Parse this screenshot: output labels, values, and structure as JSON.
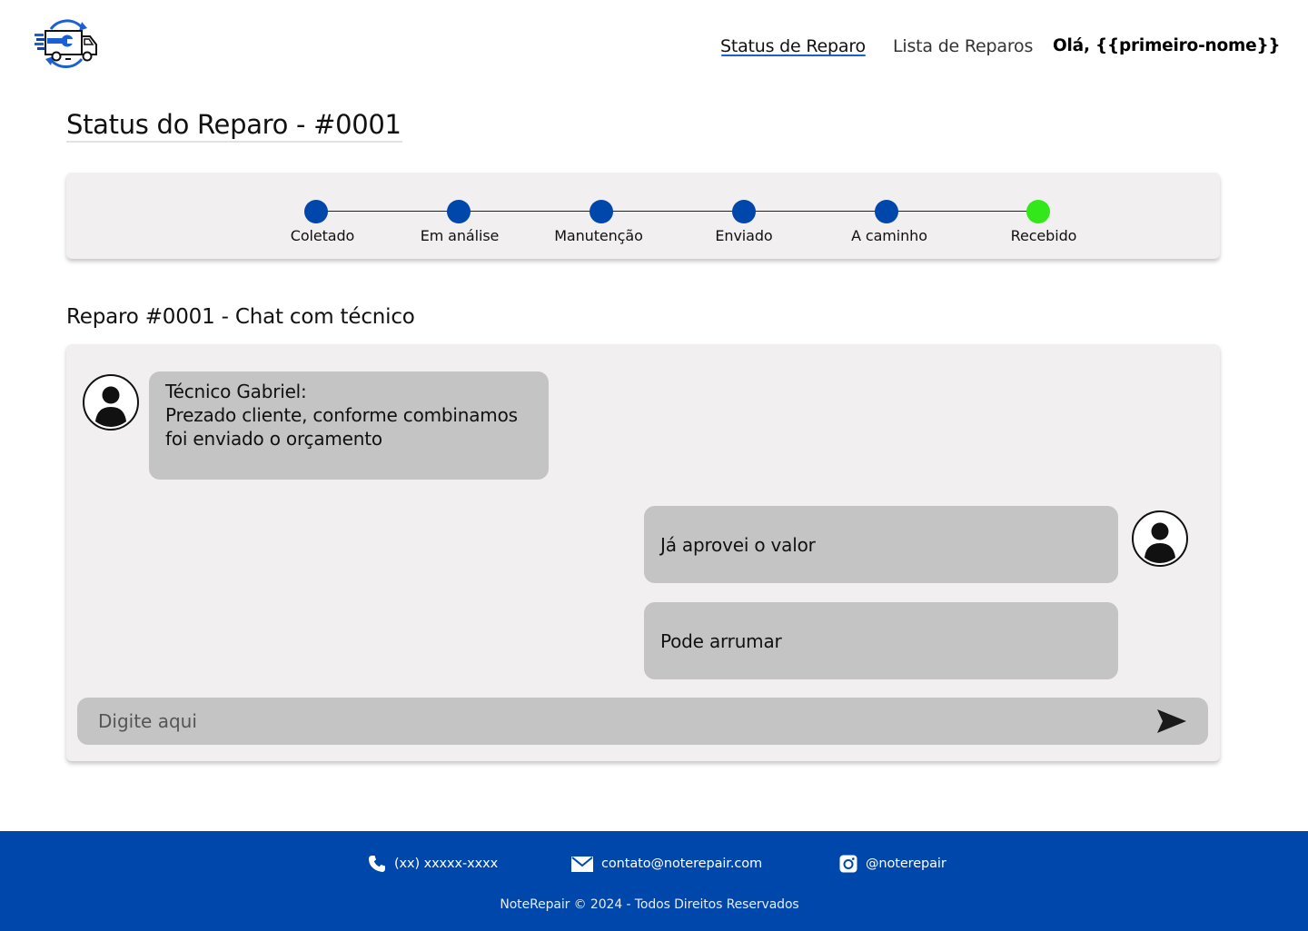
{
  "header": {
    "logo_name": "noterepair-truck-logo",
    "nav": {
      "status": "Status de Reparo",
      "list": "Lista de Reparos",
      "greeting": "Olá, {{primeiro-nome}}"
    }
  },
  "page": {
    "title": "Status do Reparo - #0001"
  },
  "progress": {
    "steps": [
      {
        "label": "Coletado",
        "state": "done"
      },
      {
        "label": "Em análise",
        "state": "done"
      },
      {
        "label": "Manutenção",
        "state": "done"
      },
      {
        "label": "Enviado",
        "state": "done"
      },
      {
        "label": "A caminho",
        "state": "done"
      },
      {
        "label": "Recebido",
        "state": "current"
      }
    ],
    "colors": {
      "done": "#0047ab",
      "current": "#32e818",
      "line": "#222222"
    }
  },
  "chat": {
    "title": "Reparo #0001 - Chat com técnico",
    "messages": [
      {
        "from": "technician",
        "lines": [
          "Técnico Gabriel:",
          "Prezado cliente, conforme combinamos",
          "foi enviado o orçamento"
        ]
      },
      {
        "from": "user",
        "text": "Já aprovei o valor"
      },
      {
        "from": "user",
        "text": "Pode arrumar"
      }
    ],
    "input": {
      "value": "",
      "placeholder": "Digite aqui"
    },
    "send_icon": "send-arrow-icon"
  },
  "footer": {
    "phone": "(xx) xxxxx-xxxx",
    "email": "contato@noterepair.com",
    "instagram": "@noterepair",
    "copyright": "NoteRepair © 2024 - Todos Direitos Reservados",
    "icons": [
      "phone-icon",
      "mail-icon",
      "instagram-icon"
    ]
  },
  "colors": {
    "brand_blue": "#0047ab",
    "card_bg": "#f1eff0",
    "bubble_bg": "#c4c4c4",
    "nav_underline": "#1a5fd6"
  }
}
